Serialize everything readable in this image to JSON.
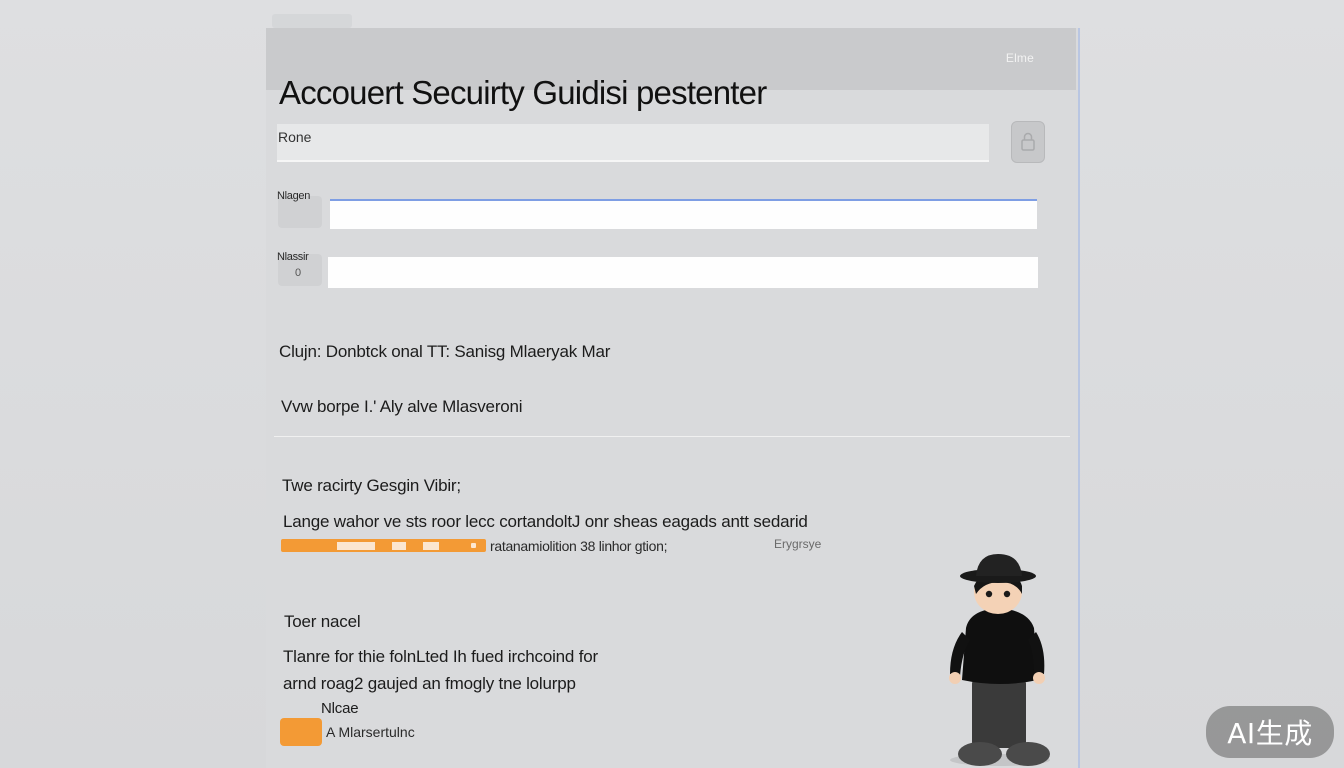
{
  "header": {
    "badge": "Elme",
    "title": "Accouert Secuirty Guidisi pestenter"
  },
  "form": {
    "role_label": "Rone",
    "field1_label": "Nlagen",
    "field2_label": "Nlassir",
    "field2_sub": "0",
    "field1_value": "",
    "field2_value": ""
  },
  "info": {
    "line1": "Clujn: Donbtck onal TT: Sanisg Mlaeryak Mar",
    "line2": "Vvw borpe I.' Aly alve Mlasveroni"
  },
  "strength": {
    "heading": "Twe racirty Gesgin Vibir;",
    "description": "Lange wahor ve sts roor lecc cortandoltJ onr sheas eagads antt sedarid",
    "caption": "ratanamiolition 38 linhor gtion;",
    "tag": "Erygrsye",
    "level": 0.45,
    "bar_color": "#f39a35"
  },
  "panel": {
    "heading": "Toer nacel",
    "text_line1": "Tlanre for thie folnLted Ih fued irchcoind for",
    "text_line2": "arnd roag2 gaujed an fmogly tne lolurpp",
    "text_line3": "Nlcae",
    "toggle_label": "A Mlarsertulnc",
    "toggle_color": "#f39a35"
  },
  "watermark": "AI生成",
  "icons": {
    "side_button": "lock-icon",
    "figure": "character-figure"
  }
}
